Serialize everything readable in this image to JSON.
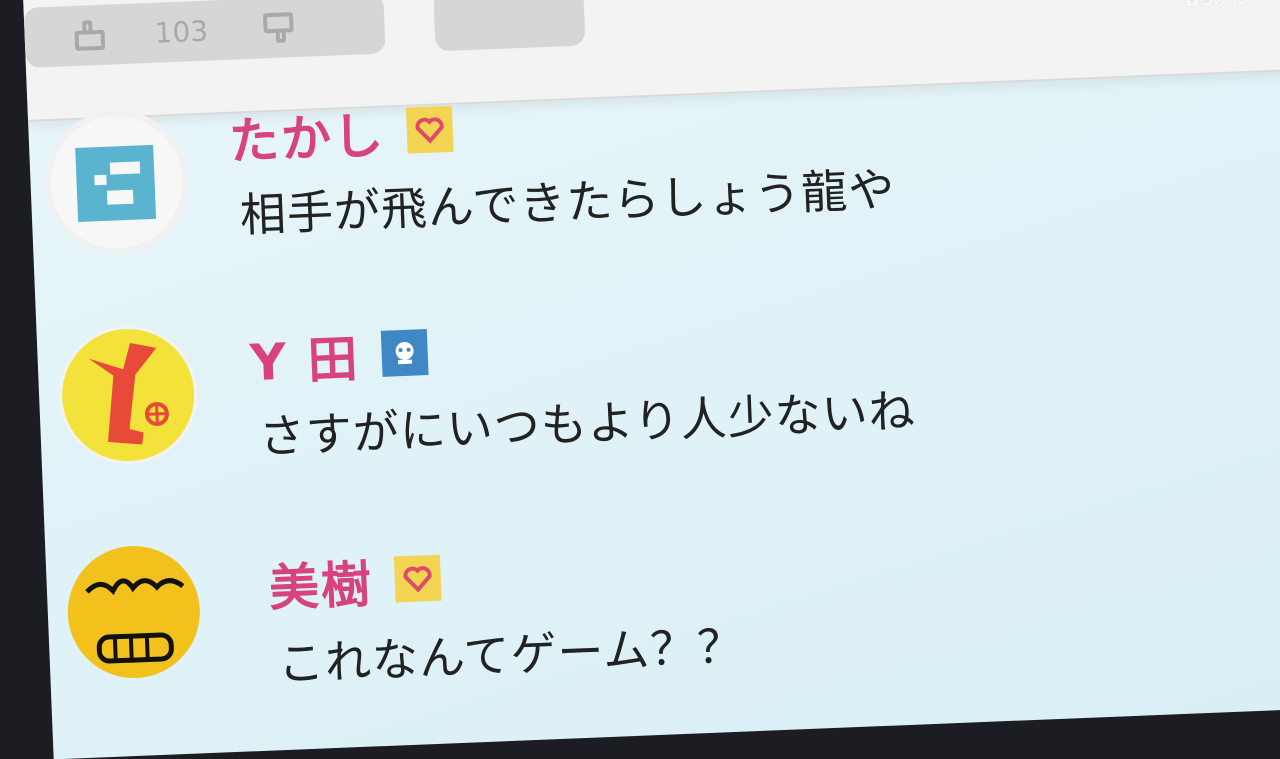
{
  "header": {
    "vote_count": "103",
    "watermark": "BSテレ"
  },
  "comments": [
    {
      "name": "たかし",
      "badge": "heart-badge-icon",
      "text": "相手が飛んできたらしょう龍や",
      "avatar": "number-6-avatar"
    },
    {
      "name": "Y 田",
      "badge": "face-badge-icon",
      "text": "さすがにいつもより人少ないね",
      "avatar": "red-figure-avatar"
    },
    {
      "name": "美樹",
      "badge": "heart-badge-icon",
      "text": "これなんてゲーム？？",
      "avatar": "yellow-face-avatar"
    }
  ],
  "colors": {
    "name": "#d7427f",
    "panel": "#e1f3f8",
    "heart_badge": "#f3d453",
    "face_badge": "#3f87c5"
  }
}
